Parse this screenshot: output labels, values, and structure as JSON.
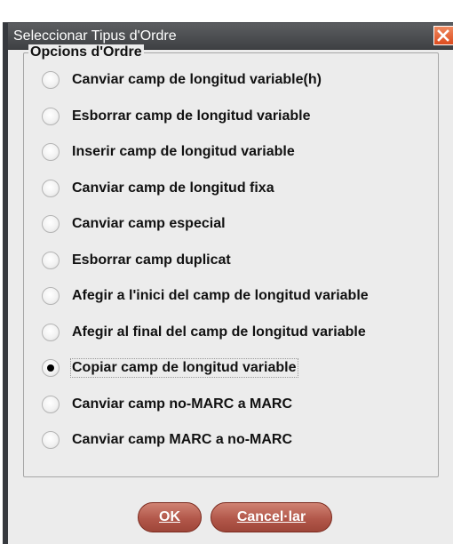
{
  "dialog": {
    "title": "Seleccionar Tipus d'Ordre",
    "close_icon": "close-icon"
  },
  "group": {
    "legend": "Opcions d'Ordre"
  },
  "options": [
    {
      "label": "Canviar camp de longitud variable(h)",
      "selected": false
    },
    {
      "label": "Esborrar camp de longitud variable",
      "selected": false
    },
    {
      "label": "Inserir camp de longitud variable",
      "selected": false
    },
    {
      "label": "Canviar camp de longitud fixa",
      "selected": false
    },
    {
      "label": "Canviar camp especial",
      "selected": false
    },
    {
      "label": "Esborrar camp duplicat",
      "selected": false
    },
    {
      "label": "Afegir a l'inici del camp de longitud variable",
      "selected": false
    },
    {
      "label": "Afegir al final del camp de longitud variable",
      "selected": false
    },
    {
      "label": "Copiar camp de longitud variable",
      "selected": true
    },
    {
      "label": "Canviar camp no-MARC a MARC",
      "selected": false
    },
    {
      "label": "Canviar camp MARC a no-MARC",
      "selected": false
    }
  ],
  "buttons": {
    "ok_label": "OK",
    "cancel_label": "Cancel·lar"
  },
  "colors": {
    "titlebar": "#4a4c4f",
    "close_button": "#e05a2c",
    "button": "#b45a4c"
  }
}
